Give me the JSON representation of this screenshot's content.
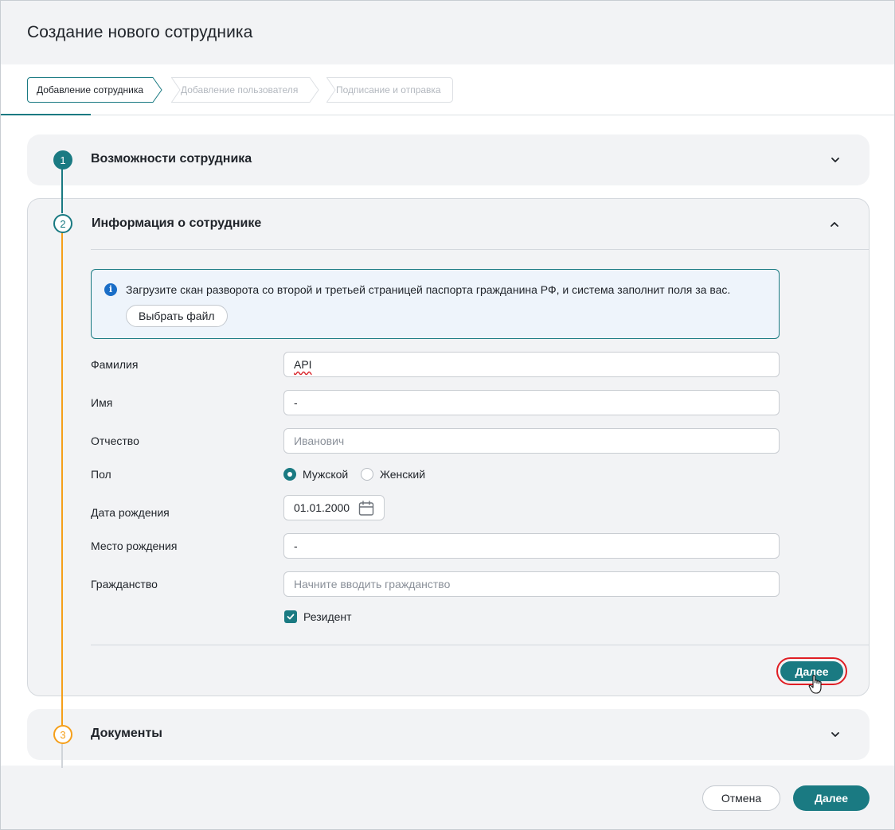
{
  "header": {
    "title": "Создание нового сотрудника"
  },
  "wizard": {
    "steps": [
      {
        "label": "Добавление сотрудника",
        "state": "active"
      },
      {
        "label": "Добавление пользователя",
        "state": "inactive"
      },
      {
        "label": "Подписание и отправка",
        "state": "inactive"
      }
    ]
  },
  "sections": [
    {
      "number": "1",
      "title": "Возможности сотрудника",
      "state": "collapsed"
    },
    {
      "number": "2",
      "title": "Информация о сотруднике",
      "state": "expanded"
    },
    {
      "number": "3",
      "title": "Документы",
      "state": "collapsed"
    }
  ],
  "upload": {
    "info_icon": "info-icon",
    "message": "Загрузите скан разворота со второй и третьей страницей паспорта гражданина РФ, и система заполнит поля за вас.",
    "button": "Выбрать файл"
  },
  "form": {
    "last_name": {
      "label": "Фамилия",
      "value": "API"
    },
    "first_name": {
      "label": "Имя",
      "value": "-"
    },
    "patronymic": {
      "label": "Отчество",
      "value": "",
      "placeholder": "Иванович"
    },
    "gender": {
      "label": "Пол",
      "options": [
        "Мужской",
        "Женский"
      ],
      "selected": "Мужской"
    },
    "birth_date": {
      "label": "Дата рождения",
      "value": "01.01.2000"
    },
    "birth_place": {
      "label": "Место рождения",
      "value": "-"
    },
    "citizenship": {
      "label": "Гражданство",
      "value": "",
      "placeholder": "Начните вводить гражданство"
    },
    "resident": {
      "label": "Резидент",
      "checked": true
    }
  },
  "section_next": "Далее",
  "footer": {
    "cancel": "Отмена",
    "next": "Далее"
  },
  "colors": {
    "accent": "#1a7a82",
    "step_next": "#f59f1a",
    "highlight": "#e01e24",
    "info": "#1a6ec7"
  }
}
